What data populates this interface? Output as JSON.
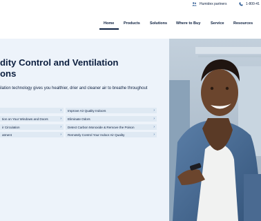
{
  "topbar": {
    "partners_label": "Humidex partners",
    "phone_label": "1-800-41"
  },
  "nav": {
    "items": [
      "Home",
      "Products",
      "Solutions",
      "Where to Buy",
      "Service",
      "Resources"
    ],
    "active": "Home"
  },
  "hero": {
    "title_line1": "dity Control and Ventilation",
    "title_line2": "ons",
    "desc_line1": "ilation technology gives you healthier, drier and cleaner air to breathe throughout",
    "desc_line2": "",
    "features_left": [
      "",
      "tion on Your Windows and Doors",
      "ir Circulation",
      "atment"
    ],
    "features_right": [
      "Improve Air Quality Indoors",
      "Eliminate Odors",
      "Detect Carbon Monoxide & Remove the Poison",
      "Remotely Control Your Indoor Air Quality"
    ],
    "chevron": "›"
  },
  "colors": {
    "navy": "#0c1f3f",
    "hero_bg": "#edf3fa",
    "feature_bg": "#dfe9f3",
    "accent": "#2e5d94"
  },
  "icons": {
    "partners": "people-icon",
    "phone": "phone-icon"
  }
}
